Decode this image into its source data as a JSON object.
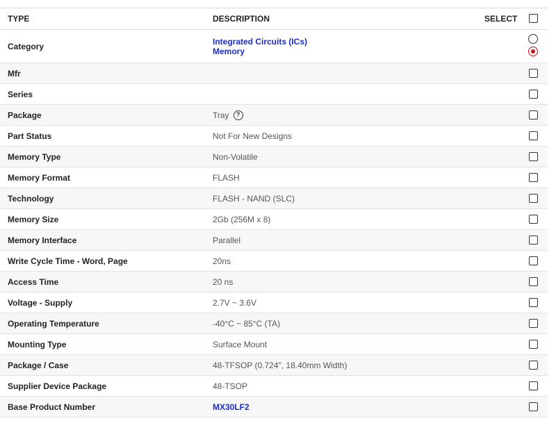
{
  "header": {
    "type": "TYPE",
    "description": "DESCRIPTION",
    "select": "SELECT"
  },
  "category": {
    "type": "Category",
    "desc_line1": "Integrated Circuits (ICs)",
    "desc_line2": "Memory"
  },
  "rows": [
    {
      "type": "Mfr",
      "desc": ""
    },
    {
      "type": "Series",
      "desc": ""
    },
    {
      "type": "Package",
      "desc": "Tray"
    },
    {
      "type": "Part Status",
      "desc": "Not For New Designs"
    },
    {
      "type": "Memory Type",
      "desc": "Non-Volatile"
    },
    {
      "type": "Memory Format",
      "desc": "FLASH"
    },
    {
      "type": "Technology",
      "desc": "FLASH - NAND (SLC)"
    },
    {
      "type": "Memory Size",
      "desc": "2Gb (256M x 8)"
    },
    {
      "type": "Memory Interface",
      "desc": "Parallel"
    },
    {
      "type": "Write Cycle Time - Word, Page",
      "desc": "20ns"
    },
    {
      "type": "Access Time",
      "desc": "20 ns"
    },
    {
      "type": "Voltage - Supply",
      "desc": "2.7V ~ 3.6V"
    },
    {
      "type": "Operating Temperature",
      "desc": "-40°C ~ 85°C (TA)"
    },
    {
      "type": "Mounting Type",
      "desc": "Surface Mount"
    },
    {
      "type": "Package / Case",
      "desc": "48-TFSOP (0.724\", 18.40mm Width)"
    },
    {
      "type": "Supplier Device Package",
      "desc": "48-TSOP"
    },
    {
      "type": "Base Product Number",
      "desc": "MX30LF2"
    }
  ],
  "icons": {
    "help": "help-question-icon",
    "help_glyph": "?"
  },
  "colors": {
    "link": "#1a2cc6",
    "radio_selected": "#cc1111"
  }
}
